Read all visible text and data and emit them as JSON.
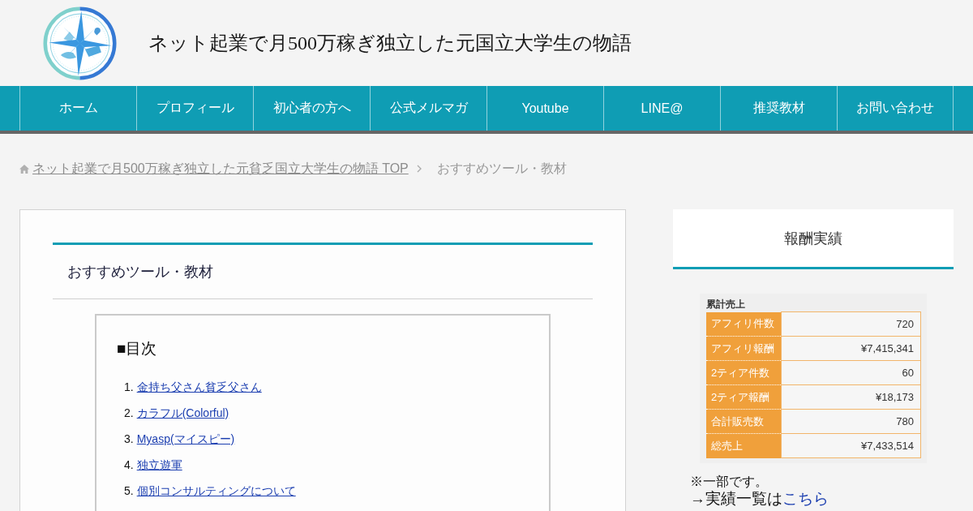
{
  "header": {
    "site_title": "ネット起業で月500万稼ぎ独立した元国立大学生の物語"
  },
  "nav": [
    {
      "label": "ホーム"
    },
    {
      "label": "プロフィール"
    },
    {
      "label": "初心者の方へ"
    },
    {
      "label": "公式メルマガ"
    },
    {
      "label": "Youtube"
    },
    {
      "label": "LINE@"
    },
    {
      "label": "推奨教材"
    },
    {
      "label": "お問い合わせ"
    }
  ],
  "breadcrumb": [
    {
      "kind": "link",
      "label": "ネット起業で月500万稼ぎ独立した元貧乏国立大学生の物語 TOP"
    },
    {
      "kind": "current",
      "label": "おすすめツール・教材"
    }
  ],
  "article": {
    "title": "おすすめツール・教材",
    "toc": {
      "heading": "■目次",
      "items": [
        {
          "number": "1.",
          "label": "金持ち父さん貧乏父さん"
        },
        {
          "number": "2.",
          "label": "カラフル(Colorful)"
        },
        {
          "number": "3.",
          "label": "Myasp(マイスピー)"
        },
        {
          "number": "4.",
          "label": "独立遊軍"
        },
        {
          "number": "5.",
          "label": "個別コンサルティングについて"
        }
      ]
    }
  },
  "sidebar": {
    "widget_title": "報酬実績",
    "earnings": {
      "caption": "累計売上",
      "rows": [
        {
          "label": "アフィリ件数",
          "value": "720"
        },
        {
          "label": "アフィリ報酬",
          "value": "¥7,415,341"
        },
        {
          "label": "2ティア件数",
          "value": "60"
        },
        {
          "label": "2ティア報酬",
          "value": "¥18,173"
        },
        {
          "label": "合計販売数",
          "value": "780"
        },
        {
          "label": "総売上",
          "value": "¥7,433,514"
        }
      ]
    },
    "note": "※一部です。",
    "results_line": {
      "text": "→実績一覧は",
      "link": "こちら"
    }
  }
}
